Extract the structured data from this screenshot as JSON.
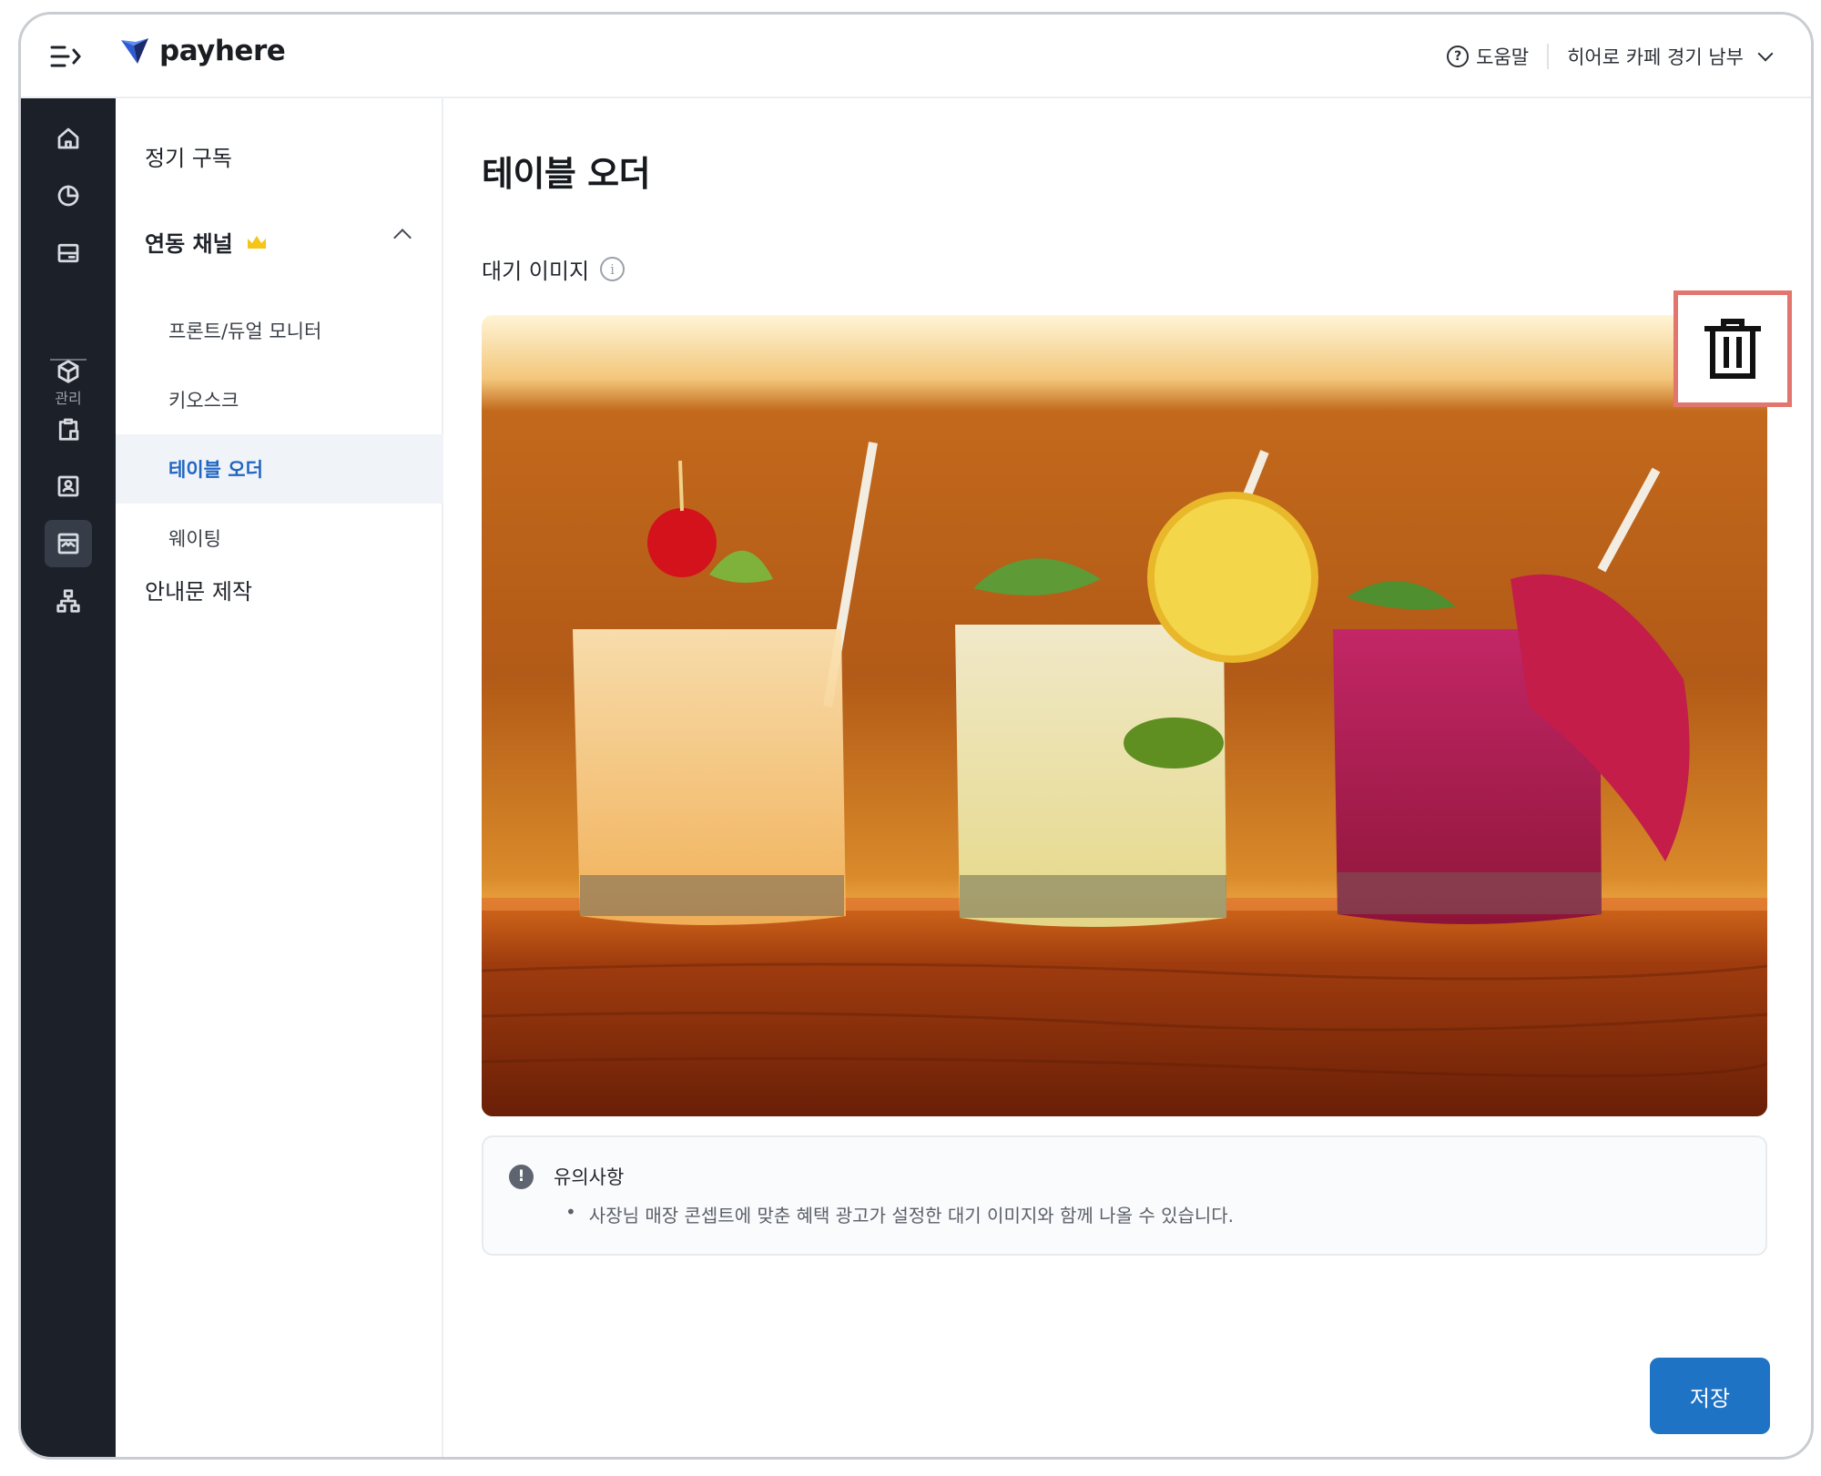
{
  "app": {
    "brand": "payhere",
    "help_label": "도움말",
    "store_name": "히어로 카페 경기 남부"
  },
  "rail": {
    "section_label": "관리",
    "icons": [
      "home-icon",
      "pie-chart-icon",
      "card-icon",
      "box-icon",
      "clipboard-icon",
      "contact-card-icon",
      "store-icon",
      "sitemap-icon"
    ],
    "active": "store-icon"
  },
  "subnav": {
    "subscription": "정기 구독",
    "linked_channels": "연동 채널",
    "linked_channels_badge": "crown-icon",
    "items": [
      {
        "label": "프론트/듀얼 모니터"
      },
      {
        "label": "키오스크"
      },
      {
        "label": "테이블 오더",
        "active": true
      },
      {
        "label": "웨이팅"
      }
    ],
    "notice_maker": "안내문 제작"
  },
  "main": {
    "title": "테이블 오더",
    "standby_image_label": "대기 이미지",
    "notice": {
      "title": "유의사항",
      "body": "사장님 매장 콘셉트에 맞춘 혜택 광고가 설정한 대기 이미지와 함께 나올 수 있습니다."
    },
    "save_label": "저장"
  },
  "colors": {
    "rail_bg": "#1c2029",
    "accent": "#1f73c4",
    "active_nav_text": "#2066c2",
    "highlight_border": "#e2756d",
    "crown": "#f5c518"
  }
}
